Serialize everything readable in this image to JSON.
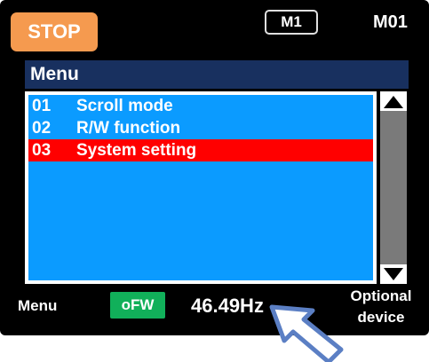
{
  "status": {
    "state_label": "STOP"
  },
  "header": {
    "mode_badge": "M1",
    "screen_code": "M01"
  },
  "menu": {
    "title": "Menu",
    "items": [
      {
        "number": "01",
        "label": "Scroll mode",
        "selected": false
      },
      {
        "number": "02",
        "label": "R/W function",
        "selected": false
      },
      {
        "number": "03",
        "label": "System setting",
        "selected": true
      }
    ]
  },
  "footer": {
    "left_label": "Menu",
    "indicator": "oFW",
    "frequency": "46.49Hz",
    "right_label_line1": "Optional",
    "right_label_line2": "device"
  },
  "colors": {
    "stop_bg": "#f59a4f",
    "header_bg": "#18305f",
    "list_bg": "#0b9bff",
    "selected_bg": "#ff0000",
    "indicator_bg": "#11b05a",
    "pointer": "#5b7fc4"
  },
  "icons": [
    "scroll-up-arrow-icon",
    "scroll-down-arrow-icon",
    "hand-pointer-arrow-icon"
  ]
}
